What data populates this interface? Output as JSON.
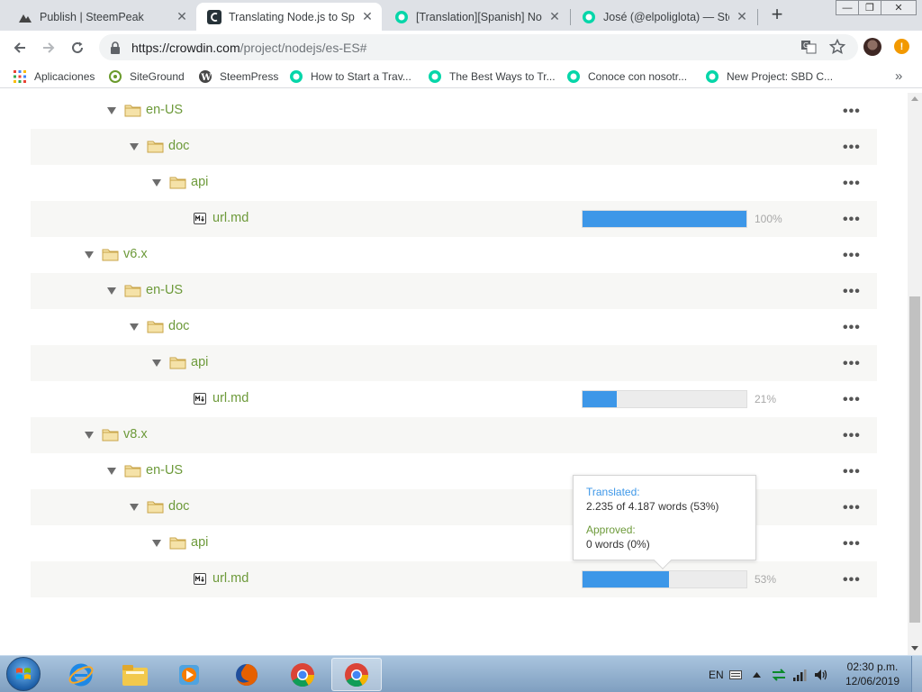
{
  "browser": {
    "tabs": [
      {
        "title": "Publish | SteemPeak",
        "icon": "steempeak-icon",
        "active": false
      },
      {
        "title": "Translating Node.js to Spanish",
        "icon": "crowdin-icon",
        "active": true
      },
      {
        "title": "[Translation][Spanish] Node.js",
        "icon": "steemit-icon",
        "active": false
      },
      {
        "title": "José (@elpoliglota) — Steemit",
        "icon": "steemit-icon",
        "active": false
      }
    ],
    "new_tab_label": "+",
    "window_controls": {
      "minimize": "—",
      "maximize": "❐",
      "close": "✕"
    },
    "url": {
      "host": "https://crowdin.com",
      "path": "/project/nodejs/es-ES#"
    },
    "alert_badge": "!"
  },
  "bookmarks": {
    "items": [
      {
        "label": "Aplicaciones",
        "icon": "apps-grid-icon"
      },
      {
        "label": "SiteGround",
        "icon": "siteground-icon"
      },
      {
        "label": "SteemPress",
        "icon": "wordpress-icon"
      },
      {
        "label": "How to Start a Trav...",
        "icon": "steemit-icon"
      },
      {
        "label": "The Best Ways to Tr...",
        "icon": "steemit-icon"
      },
      {
        "label": "Conoce con nosotr...",
        "icon": "steemit-icon"
      },
      {
        "label": "New Project: SBD C...",
        "icon": "steemit-icon"
      }
    ],
    "more": "»"
  },
  "tree": {
    "more_actions": "•••",
    "rows": [
      {
        "type": "folder",
        "label": "en-US",
        "depth": 2
      },
      {
        "type": "folder",
        "label": "doc",
        "depth": 3
      },
      {
        "type": "folder",
        "label": "api",
        "depth": 4
      },
      {
        "type": "file",
        "label": "url.md",
        "depth": 5,
        "progress": 100,
        "pct_label": "100%"
      },
      {
        "type": "folder",
        "label": "v6.x",
        "depth": 1
      },
      {
        "type": "folder",
        "label": "en-US",
        "depth": 2
      },
      {
        "type": "folder",
        "label": "doc",
        "depth": 3
      },
      {
        "type": "folder",
        "label": "api",
        "depth": 4
      },
      {
        "type": "file",
        "label": "url.md",
        "depth": 5,
        "progress": 21,
        "pct_label": "21%"
      },
      {
        "type": "folder",
        "label": "v8.x",
        "depth": 1
      },
      {
        "type": "folder",
        "label": "en-US",
        "depth": 2
      },
      {
        "type": "folder",
        "label": "doc",
        "depth": 3
      },
      {
        "type": "folder",
        "label": "api",
        "depth": 4
      },
      {
        "type": "file",
        "label": "url.md",
        "depth": 5,
        "progress": 53,
        "pct_label": "53%"
      }
    ]
  },
  "tooltip": {
    "translated_label": "Translated:",
    "translated_value": "2.235 of 4.187 words (53%)",
    "approved_label": "Approved:",
    "approved_value": "0 words (0%)"
  },
  "taskbar": {
    "apps": [
      "internet-explorer-icon",
      "file-explorer-icon",
      "media-player-icon",
      "firefox-icon",
      "chrome-icon",
      "chrome-icon"
    ],
    "language": "EN",
    "time": "02:30 p.m.",
    "date": "12/06/2019"
  },
  "colors": {
    "accent_green": "#6d9a3a",
    "progress_blue": "#3d97e8",
    "row_shade": "#f7f7f5"
  }
}
